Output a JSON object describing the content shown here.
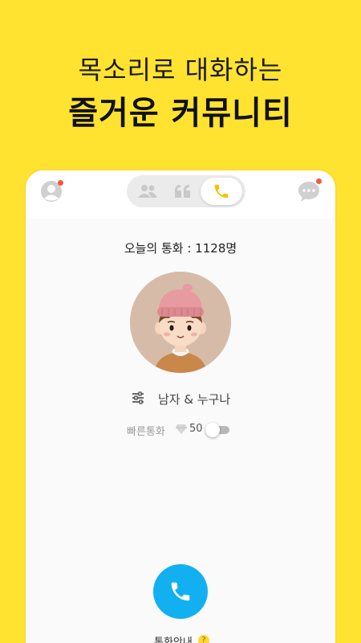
{
  "promo": {
    "line1": "목소리로 대화하는",
    "line2": "즐거운 커뮤니티"
  },
  "colors": {
    "background": "#FFE330",
    "accent": "#12b0f0",
    "notification_dot": "#ee5a44",
    "active_tab_icon": "#f5c200"
  },
  "header": {
    "left_icon": "profile-icon",
    "right_icon": "chat-bubble-icon",
    "tabs": [
      {
        "icon": "people-icon",
        "active": false
      },
      {
        "icon": "quote-icon",
        "active": false
      },
      {
        "icon": "phone-icon",
        "active": true
      }
    ]
  },
  "main": {
    "today_calls": "오늘의 통화 : 1128명",
    "filter_label": "남자 & 누구나",
    "quick_call_label": "빠른통화",
    "quick_call_cost": "50",
    "quick_call_enabled": false,
    "guide_label": "통화안내",
    "guide_badge": "?"
  }
}
